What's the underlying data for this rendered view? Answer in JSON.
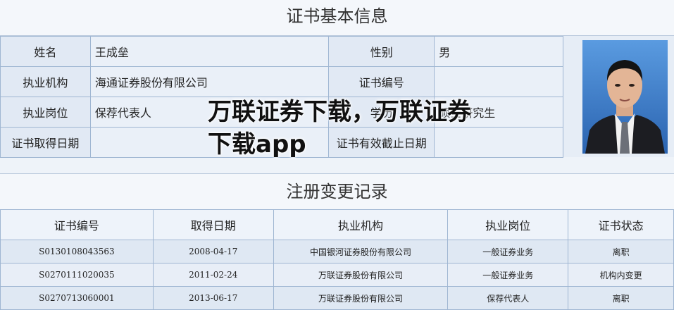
{
  "cert_info": {
    "title": "证书基本信息",
    "name_label": "姓名",
    "name_value": "王成垒",
    "gender_label": "性别",
    "gender_value": "男",
    "org_label": "执业机构",
    "org_value": "海通证券股份有限公司",
    "cert_no_label": "证书编号",
    "cert_no_value": "",
    "position_label": "执业岗位",
    "position_value": "保荐代表人",
    "education_label": "学历",
    "education_value": "硕士研究生",
    "obtain_date_label": "证书取得日期",
    "obtain_date_value": "",
    "expiry_label": "证书有效截止日期",
    "expiry_value": ""
  },
  "registration": {
    "title": "注册变更记录",
    "headers": [
      "证书编号",
      "取得日期",
      "执业机构",
      "执业岗位",
      "证书状态"
    ],
    "rows": [
      [
        "S0130108043563",
        "2008-04-17",
        "中国银河证券股份有限公司",
        "一般证券业务",
        "离职"
      ],
      [
        "S0270111020035",
        "2011-02-24",
        "万联证券股份有限公司",
        "一般证券业务",
        "机构内变更"
      ],
      [
        "S0270713060001",
        "2013-06-17",
        "万联证券股份有限公司",
        "保荐代表人",
        "离职"
      ]
    ]
  },
  "watermark": "万联证券下载，万联证券下载app"
}
